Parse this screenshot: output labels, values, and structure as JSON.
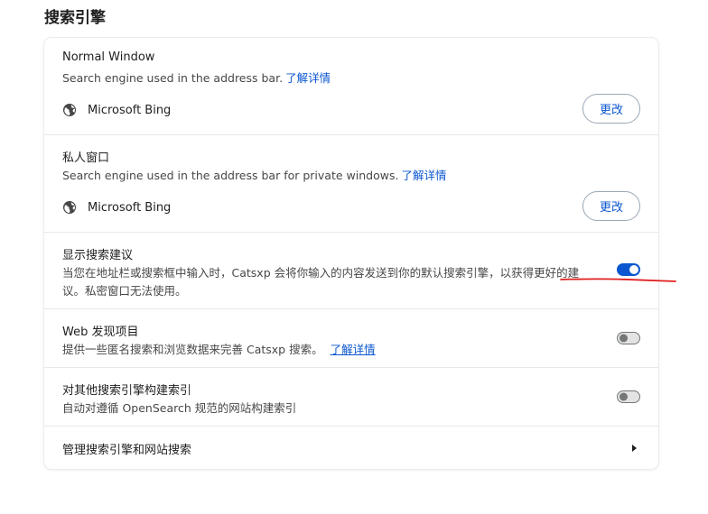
{
  "page": {
    "title": "搜索引擎"
  },
  "normal_window": {
    "title": "Normal Window",
    "description": "Search engine used in the address bar.",
    "learn_more": "了解详情",
    "engine_name": "Microsoft Bing",
    "change_button": "更改"
  },
  "private_window": {
    "title": "私人窗口",
    "description": "Search engine used in the address bar for private windows.",
    "learn_more": "了解详情",
    "engine_name": "Microsoft Bing",
    "change_button": "更改"
  },
  "suggestions": {
    "title": "显示搜索建议",
    "description_line1": "当您在地址栏或搜索框中输入时，Catsxp 会将你输入的内容发送到你的默认搜索引擎，以获得更好的建",
    "description_line2": "议。私密窗口无法使用。",
    "enabled": true
  },
  "web_discovery": {
    "title": "Web 发现项目",
    "description": "提供一些匿名搜索和浏览数据来完善 Catsxp 搜索。",
    "learn_more": "了解详情",
    "enabled": false
  },
  "index_other": {
    "title": "对其他搜索引擎构建索引",
    "description": "自动对遵循 OpenSearch 规范的网站构建索引",
    "enabled": false
  },
  "manage": {
    "title": "管理搜索引擎和网站搜索"
  },
  "colors": {
    "accent": "#0b57d0",
    "annotation": "#e02020"
  }
}
